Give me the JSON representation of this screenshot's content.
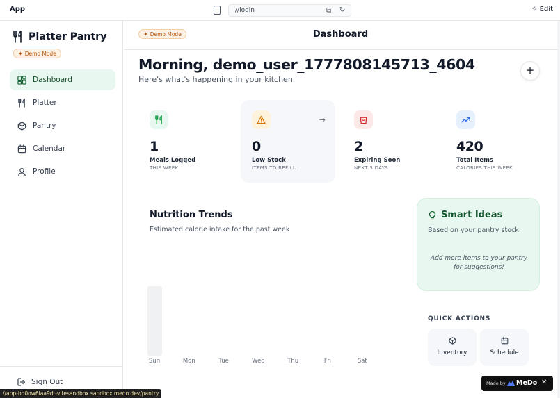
{
  "browser": {
    "app_title": "App",
    "url": "//login",
    "edit_label": "Edit",
    "status_url": "//app-bd0ow6iaa9dt-vitesandbox.sandbox.medo.dev/pantry"
  },
  "sidebar": {
    "brand": "Platter Pantry",
    "demo_badge": "Demo Mode",
    "items": [
      {
        "label": "Dashboard",
        "icon": "dashboard-icon",
        "active": true
      },
      {
        "label": "Platter",
        "icon": "utensils-icon",
        "active": false
      },
      {
        "label": "Pantry",
        "icon": "box-icon",
        "active": false
      },
      {
        "label": "Calendar",
        "icon": "calendar-icon",
        "active": false
      },
      {
        "label": "Profile",
        "icon": "user-icon",
        "active": false
      }
    ],
    "sign_out": "Sign Out"
  },
  "header": {
    "demo_badge": "Demo Mode",
    "title": "Dashboard"
  },
  "greeting": {
    "title": "Morning, demo_user_1777808145713_4604",
    "subtitle": "Here's what's happening in your kitchen."
  },
  "stats": [
    {
      "value": "1",
      "label": "Meals Logged",
      "sub": "THIS WEEK",
      "icon": "utensils-icon",
      "color": "#16a34a",
      "bg": "#e8f7ef"
    },
    {
      "value": "0",
      "label": "Low Stock",
      "sub": "ITEMS TO REFILL",
      "icon": "warning-icon",
      "color": "#d97706",
      "bg": "#fdf3dc"
    },
    {
      "value": "2",
      "label": "Expiring Soon",
      "sub": "NEXT 3 DAYS",
      "icon": "bag-icon",
      "color": "#dc2626",
      "bg": "#fde8e8"
    },
    {
      "value": "420",
      "label": "Total Items",
      "sub": "CALORIES THIS WEEK",
      "icon": "trend-icon",
      "color": "#2563eb",
      "bg": "#e6effc"
    }
  ],
  "trends": {
    "title": "Nutrition Trends",
    "subtitle": "Estimated calorie intake for the past week"
  },
  "chart_data": {
    "type": "bar",
    "categories": [
      "Sun",
      "Mon",
      "Tue",
      "Wed",
      "Thu",
      "Fri",
      "Sat"
    ],
    "values": [
      420,
      0,
      0,
      0,
      0,
      0,
      0
    ],
    "ylim": [
      0,
      420
    ],
    "grid": false,
    "bar_color": "#f0f1f3"
  },
  "smart_ideas": {
    "title": "Smart Ideas",
    "subtitle": "Based on your pantry stock",
    "message": "Add more items to your pantry for suggestions!"
  },
  "quick_actions": {
    "title": "QUICK ACTIONS",
    "items": [
      {
        "label": "Inventory",
        "icon": "box-icon"
      },
      {
        "label": "Schedule",
        "icon": "calendar-icon"
      }
    ]
  },
  "medo_badge": {
    "made_by": "Made by",
    "brand": "MeDo"
  }
}
